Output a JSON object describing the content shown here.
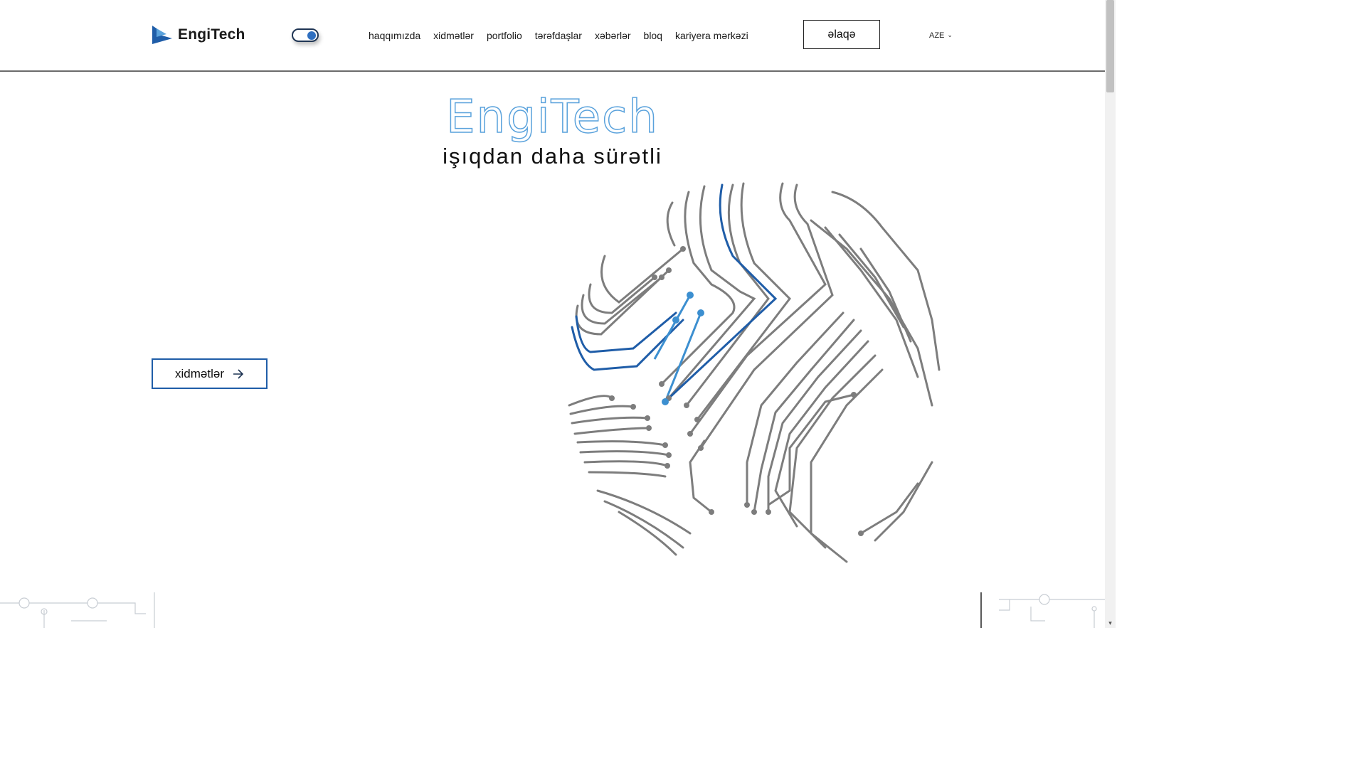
{
  "header": {
    "logo_text": "EngiTech",
    "theme_toggle": {
      "state": "on"
    },
    "nav": [
      "haqqımızda",
      "xidmətlər",
      "portfolio",
      "tərəfdaşlar",
      "xəbərlər",
      "bloq",
      "kariyera mərkəzi"
    ],
    "contact_label": "əlaqə",
    "language": "AZE"
  },
  "hero": {
    "title": "EngiTech",
    "subtitle": "işıqdan daha sürətli",
    "cta_label": "xidmətlər"
  },
  "colors": {
    "accent": "#1f5da8",
    "accent_light": "#5aa2dc",
    "circuit_gray": "#7d7d7d",
    "circuit_blue": "#1f5da8"
  },
  "icons": {
    "logo": "engitech-logo-icon",
    "cta_arrow": "arrow-right-icon",
    "lang_chevron": "chevron-down-icon"
  }
}
